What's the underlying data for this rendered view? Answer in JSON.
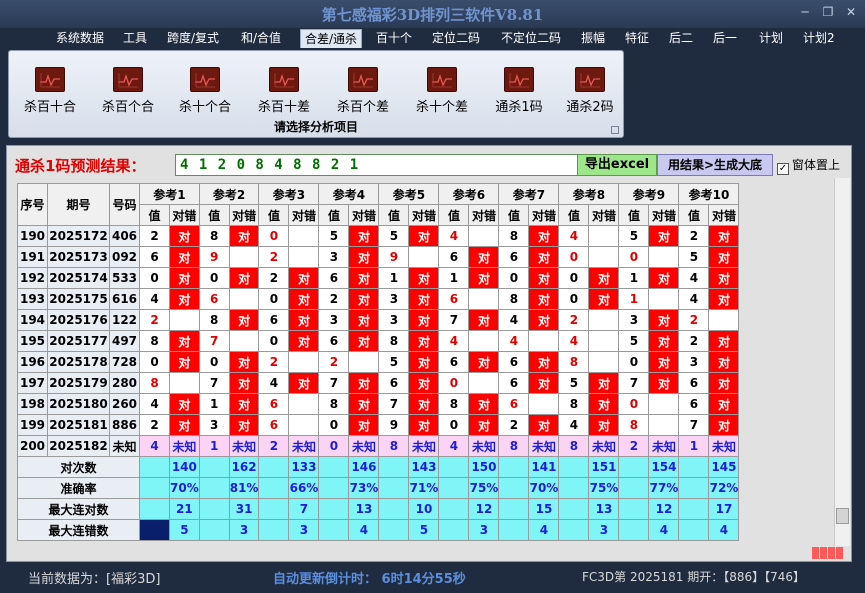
{
  "window": {
    "title": "第七感福彩3D排列三软件V8.81",
    "btn_min": "─",
    "btn_restore": "❐",
    "btn_close": "✕"
  },
  "menu": [
    "系统数据",
    "工具",
    "跨度/复式",
    "和/合值",
    "合差/通杀",
    "百十个",
    "定位二码",
    "不定位二码",
    "振幅",
    "特征",
    "后二",
    "后一",
    "计划",
    "计划2"
  ],
  "menu_active": 4,
  "ribbon": {
    "buttons": [
      "杀百十合",
      "杀百个合",
      "杀十个合",
      "杀百十差",
      "杀百个差",
      "杀十个差",
      "通杀1码",
      "通杀2码"
    ],
    "caption": "请选择分析项目"
  },
  "prediction": {
    "label": "通杀1码预测结果：",
    "value": "4 1 2 0 8 4 8 8 2 1",
    "btn_export": "导出excel",
    "btn_generate": "用结果>生成大底",
    "topmost_label": "窗体置上",
    "topmost_checked": "✓"
  },
  "table": {
    "headers": {
      "seq": "序号",
      "period": "期号",
      "number": "号码"
    },
    "ref_headers": [
      "参考1",
      "参考2",
      "参考3",
      "参考4",
      "参考5",
      "参考6",
      "参考7",
      "参考8",
      "参考9",
      "参考10"
    ],
    "sub_val": "值",
    "sub_ok": "对错",
    "ok_mark": "对",
    "rows": [
      {
        "seq": "190",
        "period": "2025172",
        "num": "406",
        "vals": [
          "2",
          "8",
          "0",
          "5",
          "5",
          "4",
          "8",
          "4",
          "5",
          "2"
        ],
        "ok": [
          1,
          1,
          0,
          1,
          1,
          0,
          1,
          0,
          1,
          1
        ]
      },
      {
        "seq": "191",
        "period": "2025173",
        "num": "092",
        "vals": [
          "6",
          "9",
          "2",
          "3",
          "9",
          "6",
          "6",
          "0",
          "0",
          "5"
        ],
        "ok": [
          1,
          0,
          0,
          1,
          0,
          1,
          1,
          0,
          0,
          1
        ]
      },
      {
        "seq": "192",
        "period": "2025174",
        "num": "533",
        "vals": [
          "0",
          "0",
          "2",
          "6",
          "1",
          "1",
          "0",
          "0",
          "1",
          "4"
        ],
        "ok": [
          1,
          1,
          1,
          1,
          1,
          1,
          1,
          1,
          1,
          1
        ]
      },
      {
        "seq": "193",
        "period": "2025175",
        "num": "616",
        "vals": [
          "4",
          "6",
          "0",
          "2",
          "3",
          "6",
          "8",
          "0",
          "1",
          "4"
        ],
        "ok": [
          1,
          0,
          1,
          1,
          1,
          0,
          1,
          1,
          0,
          1
        ]
      },
      {
        "seq": "194",
        "period": "2025176",
        "num": "122",
        "vals": [
          "2",
          "8",
          "6",
          "3",
          "3",
          "7",
          "4",
          "2",
          "3",
          "2"
        ],
        "ok": [
          0,
          1,
          1,
          1,
          1,
          1,
          1,
          0,
          1,
          0
        ]
      },
      {
        "seq": "195",
        "period": "2025177",
        "num": "497",
        "vals": [
          "8",
          "7",
          "0",
          "6",
          "8",
          "4",
          "4",
          "4",
          "5",
          "2"
        ],
        "ok": [
          1,
          0,
          1,
          1,
          1,
          0,
          0,
          0,
          1,
          1
        ]
      },
      {
        "seq": "196",
        "period": "2025178",
        "num": "728",
        "vals": [
          "0",
          "0",
          "2",
          "2",
          "5",
          "6",
          "6",
          "8",
          "0",
          "3"
        ],
        "ok": [
          1,
          1,
          0,
          0,
          1,
          1,
          1,
          0,
          1,
          1
        ]
      },
      {
        "seq": "197",
        "period": "2025179",
        "num": "280",
        "vals": [
          "8",
          "7",
          "4",
          "7",
          "6",
          "0",
          "6",
          "5",
          "7",
          "6"
        ],
        "ok": [
          0,
          1,
          1,
          1,
          1,
          0,
          1,
          1,
          1,
          1
        ]
      },
      {
        "seq": "198",
        "period": "2025180",
        "num": "260",
        "vals": [
          "4",
          "1",
          "6",
          "8",
          "7",
          "8",
          "6",
          "8",
          "0",
          "6"
        ],
        "ok": [
          1,
          1,
          0,
          1,
          1,
          1,
          0,
          1,
          0,
          1
        ]
      },
      {
        "seq": "199",
        "period": "2025181",
        "num": "886",
        "vals": [
          "2",
          "3",
          "6",
          "0",
          "9",
          "0",
          "2",
          "4",
          "8",
          "7"
        ],
        "ok": [
          1,
          1,
          0,
          1,
          1,
          1,
          1,
          1,
          0,
          1
        ]
      }
    ],
    "pending": {
      "seq": "200",
      "period": "2025182",
      "num": "未知",
      "vals": [
        "4",
        "1",
        "2",
        "0",
        "8",
        "4",
        "8",
        "8",
        "2",
        "1"
      ],
      "mark": "未知"
    },
    "stats": {
      "labels": [
        "对次数",
        "准确率",
        "最大连对数",
        "最大连错数"
      ],
      "hits": [
        "140",
        "162",
        "133",
        "146",
        "143",
        "150",
        "141",
        "151",
        "154",
        "145"
      ],
      "acc": [
        "70%",
        "81%",
        "66%",
        "73%",
        "71%",
        "75%",
        "70%",
        "75%",
        "77%",
        "72%"
      ],
      "max_ok": [
        "21",
        "31",
        "7",
        "13",
        "10",
        "12",
        "15",
        "13",
        "12",
        "17"
      ],
      "max_err": [
        "5",
        "3",
        "3",
        "4",
        "5",
        "3",
        "4",
        "3",
        "4",
        "4"
      ]
    }
  },
  "status": {
    "left": "当前数据为：[福彩3D]",
    "center": "自动更新倒计时： 6时14分55秒",
    "right": "FC3D第 2025181 期开：【886】【746】"
  }
}
